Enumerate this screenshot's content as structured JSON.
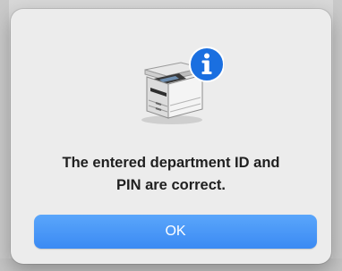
{
  "dialog": {
    "icon": "printer-with-info-badge",
    "message_line1": "The entered department ID and",
    "message_line2": "PIN are correct.",
    "ok_label": "OK"
  },
  "colors": {
    "dialog_bg": "#ececec",
    "button_blue": "#3b8af3",
    "badge_blue": "#1a6fe0"
  }
}
